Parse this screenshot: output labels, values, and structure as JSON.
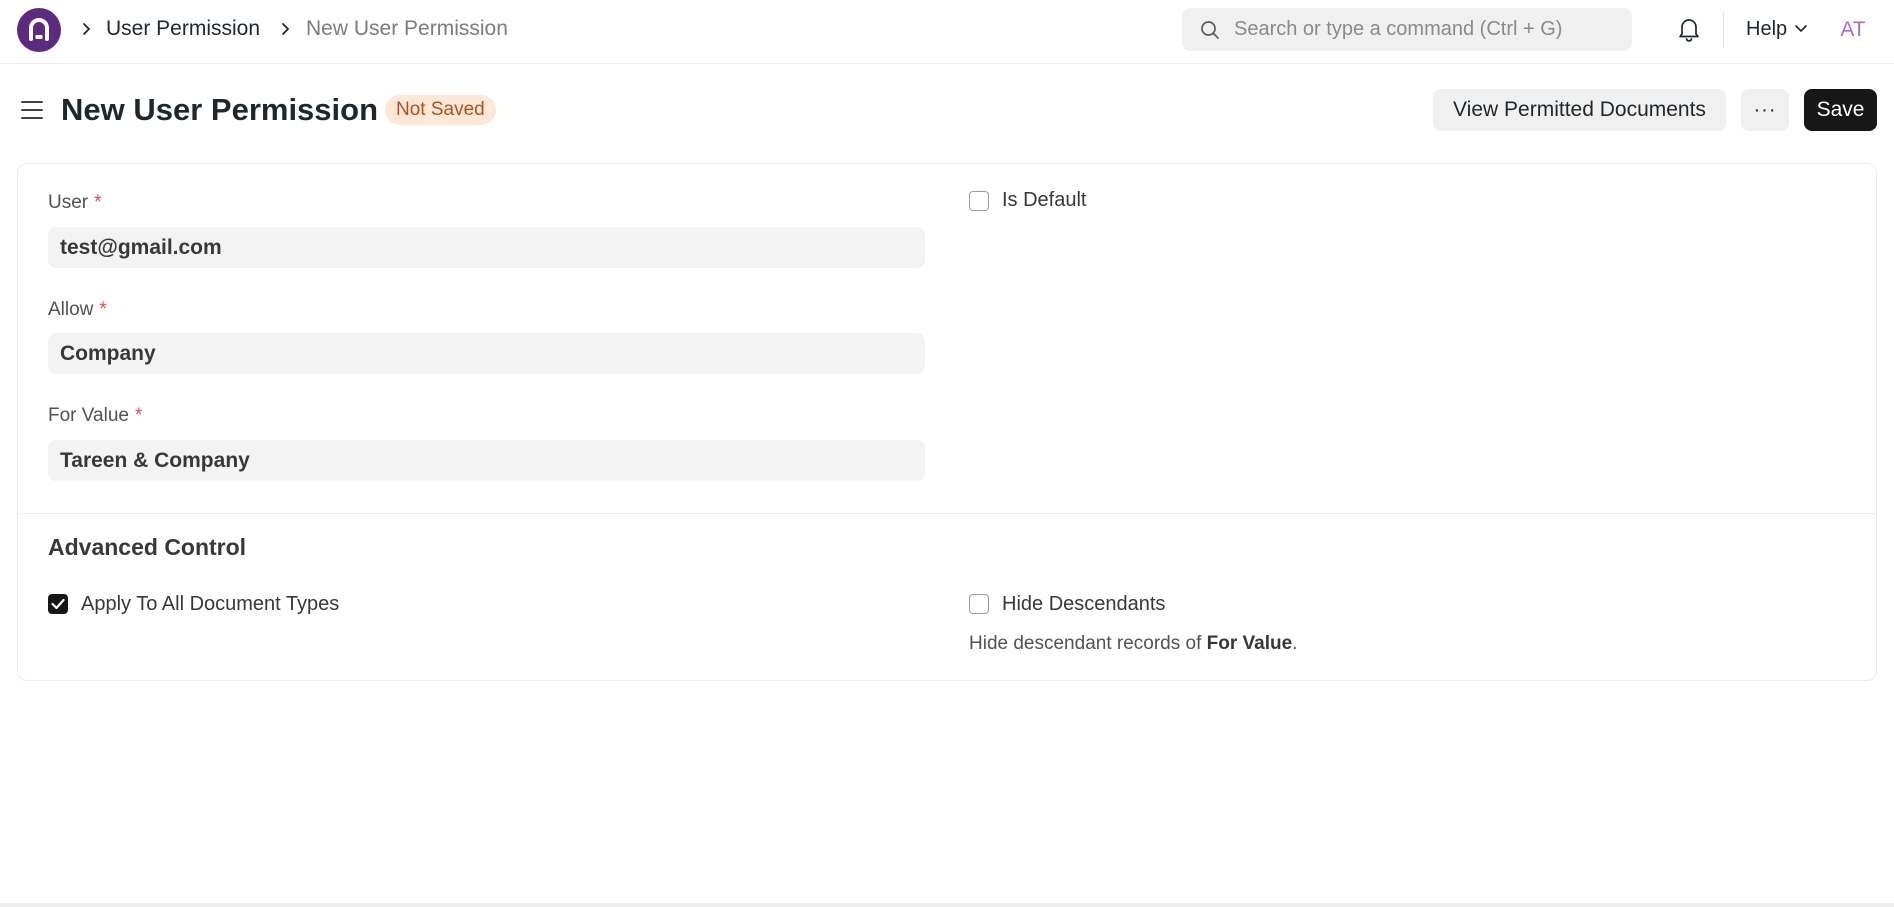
{
  "breadcrumb": {
    "items": [
      "User Permission",
      "New User Permission"
    ]
  },
  "search": {
    "placeholder": "Search or type a command (Ctrl + G)"
  },
  "navbar": {
    "help_label": "Help",
    "avatar_initials": "AT"
  },
  "page": {
    "title": "New User Permission",
    "status": "Not Saved",
    "status_color": "#b0501f"
  },
  "actions": {
    "view_permitted_label": "View Permitted Documents",
    "more_label": "···",
    "save_label": "Save"
  },
  "form": {
    "user": {
      "label": "User",
      "required": "*",
      "value": "test@gmail.com"
    },
    "allow": {
      "label": "Allow",
      "required": "*",
      "value": "Company"
    },
    "for_value": {
      "label": "For Value",
      "required": "*",
      "value": "Tareen & Company"
    },
    "is_default": {
      "label": "Is Default",
      "checked": false
    }
  },
  "advanced": {
    "title": "Advanced Control",
    "apply_all": {
      "label": "Apply To All Document Types",
      "checked": true
    },
    "hide_descendants": {
      "label": "Hide Descendants",
      "checked": false
    },
    "description_prefix": "Hide descendant records of ",
    "description_bold": "For Value",
    "description_suffix": "."
  },
  "colors": {
    "brand": "#5c2a7e",
    "primary_button": "#171717",
    "required_mark": "#e24c4c",
    "avatar": "#a36be0"
  },
  "icons": [
    "app-logo-icon",
    "chevron-right-icon",
    "search-icon",
    "bell-icon",
    "chevron-down-icon",
    "hamburger-icon",
    "checkmark-icon"
  ]
}
